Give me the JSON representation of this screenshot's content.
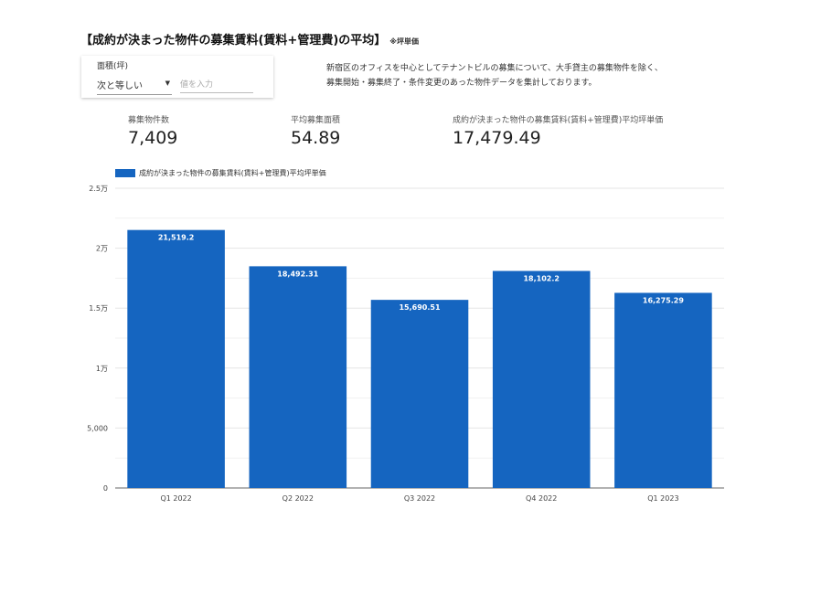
{
  "header": {
    "title": "【成約が決まった物件の募集賃料(賃料+管理費)の平均】",
    "note": "※坪単価"
  },
  "filter": {
    "label": "面積(坪)",
    "operator": "次と等しい",
    "placeholder": "値を入力"
  },
  "description": {
    "line1": "新宿区のオフィスを中心としてテナントビルの募集について、大手貸主の募集物件を除く、",
    "line2": "募集開始・募集終了・条件変更のあった物件データを集計しております。"
  },
  "stats": [
    {
      "label": "募集物件数",
      "value": "7,409"
    },
    {
      "label": "平均募集面積",
      "value": "54.89"
    },
    {
      "label": "成約が決まった物件の募集賃料(賃料+管理費)平均坪単価",
      "value": "17,479.49"
    }
  ],
  "colors": {
    "bar": "#1565c0",
    "grid": "#e6e6e6",
    "axis": "#666666"
  },
  "chart_data": {
    "type": "bar",
    "categories": [
      "Q1 2022",
      "Q2 2022",
      "Q3 2022",
      "Q4 2022",
      "Q1 2023"
    ],
    "series": [
      {
        "name": "成約が決まった物件の募集賃料(賃料+管理費)平均坪単価",
        "values": [
          21519.2,
          18492.31,
          15690.51,
          18102.2,
          16275.29
        ],
        "labels": [
          "21,519.2",
          "18,492.31",
          "15,690.51",
          "18,102.2",
          "16,275.29"
        ]
      }
    ],
    "ylim": [
      0,
      25000
    ],
    "yticks": [
      0,
      5000,
      10000,
      15000,
      20000,
      25000
    ],
    "ytick_labels": [
      "0",
      "5,000",
      "1万",
      "1.5万",
      "2万",
      "2.5万"
    ],
    "grid": true,
    "legend": "top-left"
  }
}
